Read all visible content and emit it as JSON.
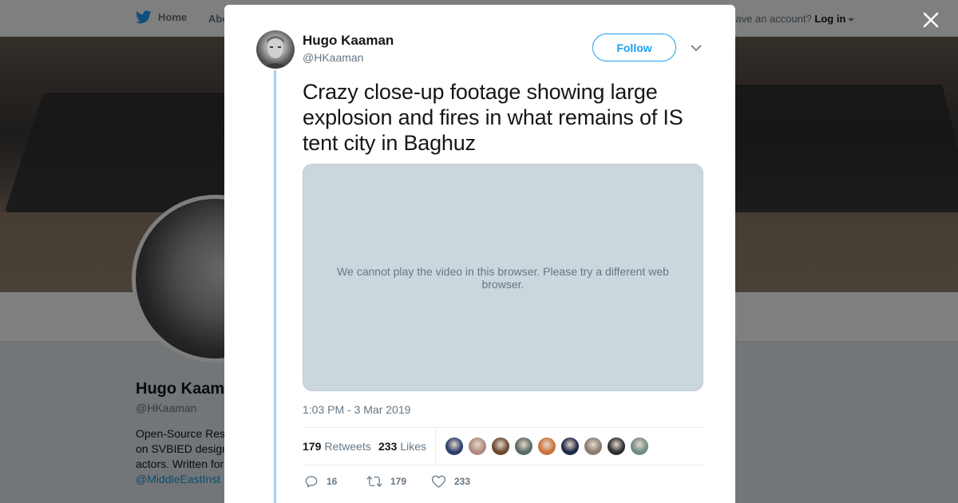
{
  "nav": {
    "home_label": "Home",
    "about_label": "About",
    "account_prompt": "Have an account?",
    "login_label": "Log in"
  },
  "profile": {
    "name": "Hugo Kaaman",
    "handle": "@HKaaman",
    "bio_lines": [
      "Open-Source Researcher.",
      "on SVBIED design",
      "actors. Written for"
    ],
    "bio_link": "@MiddleEastInst"
  },
  "tweet": {
    "author_name": "Hugo Kaaman",
    "author_handle": "@HKaaman",
    "follow_label": "Follow",
    "text": "Crazy close-up footage showing large explosion and fires in what remains of IS tent city in Baghuz",
    "video_message": "We cannot play the video in this browser. Please try a different web browser.",
    "timestamp": "1:03 PM - 3 Mar 2019",
    "retweets_count": "179",
    "retweets_label": "Retweets",
    "likes_count": "233",
    "likes_label": "Likes",
    "reply_count": "16",
    "retweet_count": "179",
    "like_count": "233"
  },
  "likers": [
    {
      "name": "liker-1",
      "color": "#2b3f6b"
    },
    {
      "name": "liker-2",
      "color": "#b08a7e"
    },
    {
      "name": "liker-3",
      "color": "#6a4a32"
    },
    {
      "name": "liker-4",
      "color": "#5a6b63"
    },
    {
      "name": "liker-5",
      "color": "#c9733a"
    },
    {
      "name": "liker-6",
      "color": "#1e2a4a"
    },
    {
      "name": "liker-7",
      "color": "#8a7c72"
    },
    {
      "name": "liker-8",
      "color": "#2d2f33"
    },
    {
      "name": "liker-9",
      "color": "#6f8c85"
    }
  ],
  "colors": {
    "accent": "#1da1f2",
    "text_primary": "#14171a",
    "text_secondary": "#657786"
  }
}
